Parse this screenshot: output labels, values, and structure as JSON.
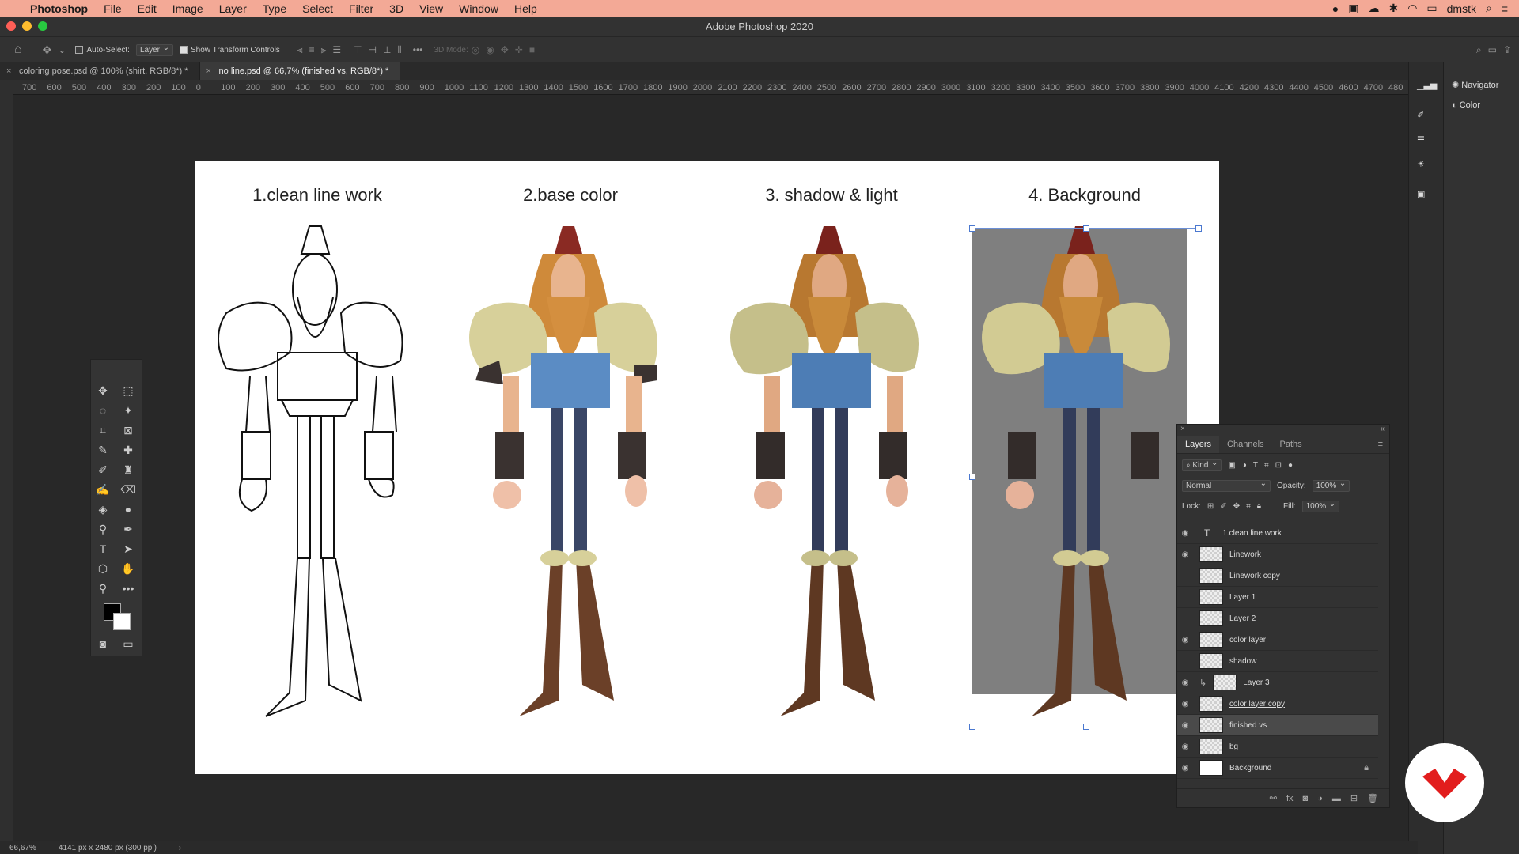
{
  "menubar": {
    "app": "Photoshop",
    "items": [
      "File",
      "Edit",
      "Image",
      "Layer",
      "Type",
      "Select",
      "Filter",
      "3D",
      "View",
      "Window",
      "Help"
    ],
    "user": "dmstk"
  },
  "window": {
    "title": "Adobe Photoshop 2020"
  },
  "options": {
    "auto_select_label": "Auto-Select:",
    "auto_select_value": "Layer",
    "show_transform_label": "Show Transform Controls",
    "mode_3d_label": "3D Mode:"
  },
  "tabs": [
    {
      "label": "coloring pose.psd @ 100% (shirt, RGB/8*) *"
    },
    {
      "label": "no line.psd @ 66,7% (finished vs, RGB/8*) *"
    }
  ],
  "ruler": [
    "700",
    "600",
    "500",
    "400",
    "300",
    "200",
    "100",
    "0",
    "100",
    "200",
    "300",
    "400",
    "500",
    "600",
    "700",
    "800",
    "900",
    "1000",
    "1100",
    "1200",
    "1300",
    "1400",
    "1500",
    "1600",
    "1700",
    "1800",
    "1900",
    "2000",
    "2100",
    "2200",
    "2300",
    "2400",
    "2500",
    "2600",
    "2700",
    "2800",
    "2900",
    "3000",
    "3100",
    "3200",
    "3300",
    "3400",
    "3500",
    "3600",
    "3700",
    "3800",
    "3900",
    "4000",
    "4100",
    "4200",
    "4300",
    "4400",
    "4500",
    "4600",
    "4700",
    "480"
  ],
  "canvas": {
    "titles": [
      "1.clean line work",
      "2.base color",
      "3. shadow & light",
      "4. Background"
    ]
  },
  "dock": {
    "navigator": "Navigator",
    "color": "Color"
  },
  "layers_panel": {
    "tabs": [
      "Layers",
      "Channels",
      "Paths"
    ],
    "kind": "Kind",
    "blend_mode": "Normal",
    "opacity_label": "Opacity:",
    "opacity_value": "100%",
    "lock_label": "Lock:",
    "fill_label": "Fill:",
    "fill_value": "100%",
    "layers": [
      {
        "name": "1.clean line work",
        "visible": true,
        "type": "text"
      },
      {
        "name": "Linework",
        "visible": true
      },
      {
        "name": "Linework copy",
        "visible": false
      },
      {
        "name": "Layer 1",
        "visible": false
      },
      {
        "name": "Layer 2",
        "visible": false
      },
      {
        "name": "color layer",
        "visible": true
      },
      {
        "name": "shadow",
        "visible": false
      },
      {
        "name": "Layer 3",
        "visible": true,
        "clipped": true
      },
      {
        "name": "color layer copy",
        "visible": true
      },
      {
        "name": "finished vs",
        "visible": true,
        "selected": true
      },
      {
        "name": "bg",
        "visible": true
      },
      {
        "name": "Background",
        "visible": true,
        "locked": true
      }
    ]
  },
  "status": {
    "zoom": "66,67%",
    "doc": "4141 px x 2480 px (300 ppi)"
  }
}
